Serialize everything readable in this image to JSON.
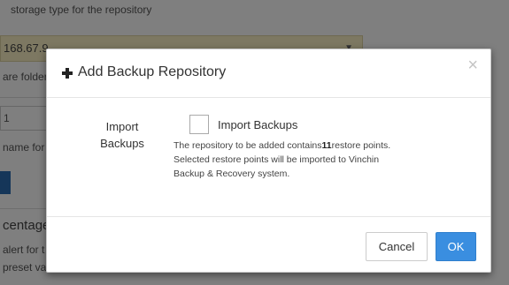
{
  "background": {
    "description_fragment": "storage type for the repository",
    "host_fragment": "168.67.9",
    "folder_fragment": "are folder,",
    "value_fragment": "1",
    "name_fragment": "name for t",
    "heading_fragment": "centage",
    "alert_fragment": "alert for t",
    "preset_fragment": "preset va"
  },
  "dialog": {
    "title": "Add Backup Repository",
    "close_symbol": "×",
    "field": {
      "label_line1": "Import",
      "label_line2": "Backups",
      "checkbox_label": "Import Backups",
      "checked": false,
      "help_prefix": "The repository to be added contains",
      "restore_point_count": "11",
      "help_suffix": "restore points.",
      "help_line2": "Selected restore points will be imported to Vinchin",
      "help_line3": "Backup & Recovery system."
    },
    "buttons": {
      "cancel": "Cancel",
      "ok": "OK"
    }
  },
  "colors": {
    "primary": "#3a8ee0",
    "overlay": "rgba(0,0,0,0.5)",
    "highlight": "#fbf1c4"
  }
}
